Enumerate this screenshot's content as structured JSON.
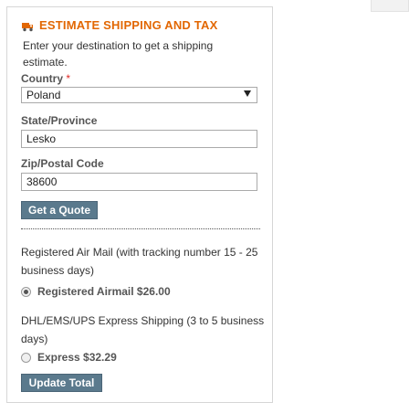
{
  "panel": {
    "title": "Estimate Shipping and Tax",
    "icon": "truck-icon",
    "intro": "Enter your destination to get a shipping estimate.",
    "accent_color": "#e26703"
  },
  "form": {
    "country": {
      "label": "Country",
      "required_mark": "*",
      "value": "Poland"
    },
    "state": {
      "label": "State/Province",
      "value": "Lesko"
    },
    "zip": {
      "label": "Zip/Postal Code",
      "value": "38600"
    },
    "quote_button": "Get a Quote"
  },
  "shipping_methods": [
    {
      "title": "Registered Air Mail (with tracking number 15 - 25 business days)",
      "option_label": "Registered Airmail $26.00",
      "selected": true
    },
    {
      "title": "DHL/EMS/UPS Express Shipping (3 to 5 business days)",
      "option_label": "Express $32.29",
      "selected": false
    }
  ],
  "update_button": "Update Total",
  "button_color": "#5b7a8d"
}
